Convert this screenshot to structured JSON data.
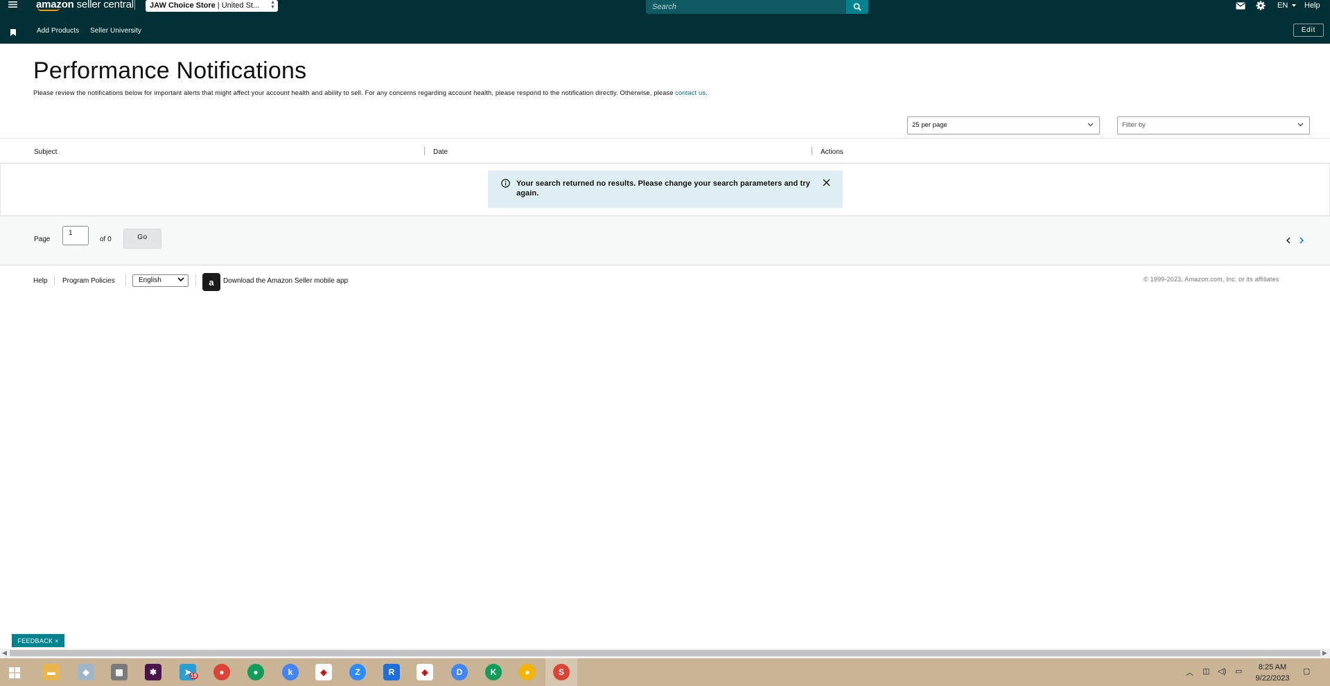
{
  "topbar": {
    "brand_bold": "amazon",
    "brand_rest": " seller central",
    "store_bold": "JAW Choice Store",
    "store_rest": " | United St...",
    "search_placeholder": "Search",
    "lang": "EN",
    "help": "Help"
  },
  "navbar": {
    "links": [
      "Add Products",
      "Seller University"
    ],
    "edit": "Edit"
  },
  "page": {
    "title": "Performance Notifications",
    "description": "Please review the notifications below for important alerts that might affect your account health and ability to sell. For any concerns regarding account health, please respond to the notification directly. Otherwise, please ",
    "contact_link": "contact us",
    "description_end": "."
  },
  "controls": {
    "per_page": "25 per page",
    "filter_placeholder": "Filter by"
  },
  "table": {
    "columns": [
      "Subject",
      "Date",
      "Actions"
    ],
    "alert_message": "Your search returned no results. Please change your search parameters and try again."
  },
  "pager": {
    "page_label": "Page",
    "page_value": "1",
    "of_label": "of 0",
    "go": "Go"
  },
  "footer": {
    "help": "Help",
    "program_policies": "Program Policies",
    "language": "English",
    "app_icon": "a",
    "download_app": "Download the Amazon Seller mobile app",
    "copyright": "© 1999-2023, Amazon.com, Inc. or its affiliates"
  },
  "feedback": {
    "label": "FEEDBACK",
    "close": "×"
  },
  "taskbar": {
    "time": "8:25 AM",
    "date": "9/22/2023",
    "badge_19": "19",
    "chrome_k": "k",
    "chrome_d": "D",
    "chrome_k2": "K",
    "chrome_s": "S",
    "zoom_z": "Z",
    "rr_r": "R"
  },
  "colors": {
    "header_bg": "#002f36",
    "accent": "#00838f",
    "link": "#007185",
    "alert_bg": "#dfeef0"
  }
}
